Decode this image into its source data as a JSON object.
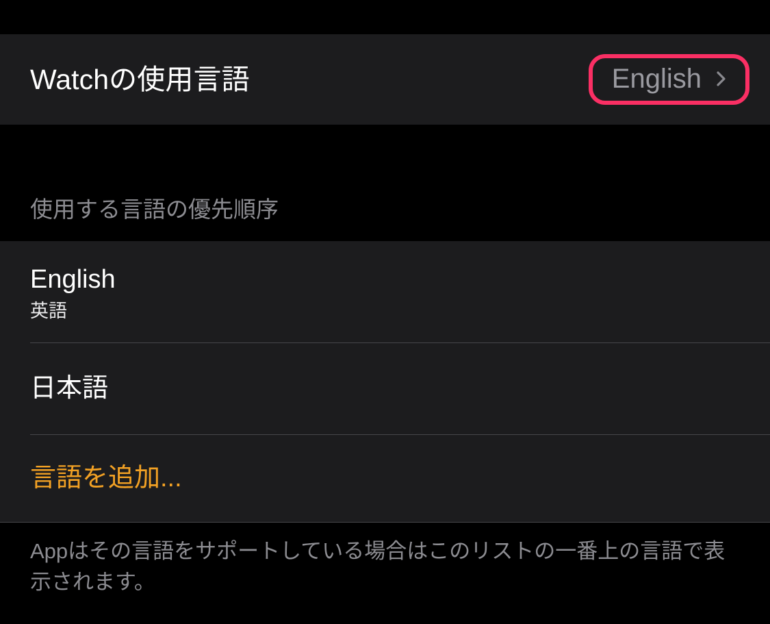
{
  "header": {
    "title": "Watchの使用言語",
    "value": "English",
    "chevron_icon": "chevron-right-icon",
    "highlight_color": "#FA2F64",
    "highlighted": true
  },
  "section": {
    "header_label": "使用する言語の優先順序"
  },
  "list": {
    "items": [
      {
        "title": "English",
        "subtitle": "英語",
        "type": "language"
      },
      {
        "title": "日本語",
        "subtitle": "",
        "type": "language"
      },
      {
        "title": "言語を追加...",
        "subtitle": "",
        "type": "action",
        "accent_color": "#F2A124"
      }
    ]
  },
  "footer": {
    "note": "Appはその言語をサポートしている場合はこのリストの一番上の言語で表示されます。"
  },
  "theme": {
    "background": "#000000",
    "panel_background": "#1C1C1E",
    "separator": "#46464A",
    "primary_text": "#FFFFFF",
    "secondary_text": "#8C8C91",
    "accent_orange": "#F2A124",
    "highlight_pink": "#FA2F64"
  }
}
